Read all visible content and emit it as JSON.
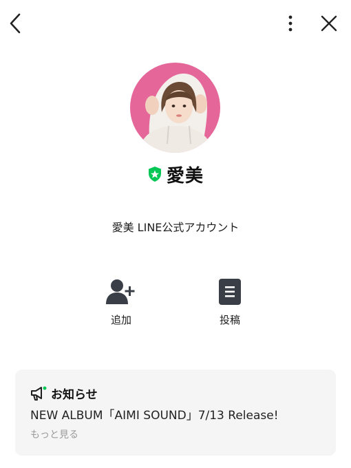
{
  "header": {
    "back_icon": "chevron-left-icon",
    "more_icon": "vertical-dots-icon",
    "close_icon": "close-icon"
  },
  "profile": {
    "name": "愛美",
    "badge_icon": "verified-shield-icon",
    "badge_color": "#06c755",
    "avatar_ring_color": "#e5679a",
    "description": "愛美 LINE公式アカウント"
  },
  "actions": [
    {
      "label": "追加",
      "icon": "add-friend-icon"
    },
    {
      "label": "投稿",
      "icon": "post-document-icon"
    }
  ],
  "notice": {
    "title": "お知らせ",
    "icon": "megaphone-icon",
    "dot_color": "#06c755",
    "body": "NEW ALBUM「AIMI SOUND」7/13 Release!",
    "more_label": "もっと見る"
  }
}
